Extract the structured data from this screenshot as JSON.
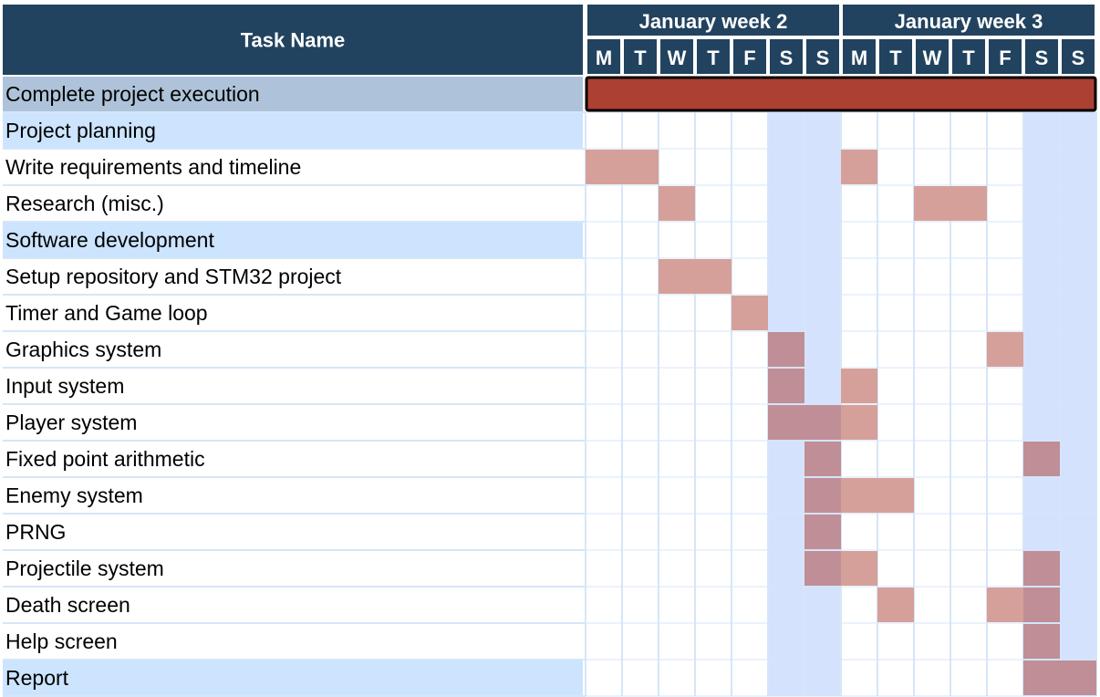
{
  "header": {
    "task_name_label": "Task Name",
    "weeks": [
      {
        "label": "January week 2",
        "days": [
          "M",
          "T",
          "W",
          "T",
          "F",
          "S",
          "S"
        ]
      },
      {
        "label": "January week 3",
        "days": [
          "M",
          "T",
          "W",
          "T",
          "F",
          "S",
          "S"
        ]
      }
    ]
  },
  "weekend_day_indices": [
    5,
    6,
    12,
    13
  ],
  "colors": {
    "header_bg": "#22435f",
    "summary_row": "#aec3d9",
    "group_row": "#cce4fd",
    "weekend_column": "#d5e2fe",
    "grid_line": "#d5e6f8",
    "summary_bar": "#ab4033",
    "task_block": "#d6a09a",
    "task_block_weekend": "#c08e97"
  },
  "chart_data": {
    "type": "gantt",
    "days": [
      "M",
      "T",
      "W",
      "T",
      "F",
      "S",
      "S",
      "M",
      "T",
      "W",
      "T",
      "F",
      "S",
      "S"
    ],
    "tasks": [
      {
        "name": "Complete project execution",
        "kind": "summary",
        "active_days": [
          0,
          1,
          2,
          3,
          4,
          5,
          6,
          7,
          8,
          9,
          10,
          11,
          12,
          13
        ]
      },
      {
        "name": "Project planning",
        "kind": "group",
        "active_days": []
      },
      {
        "name": "Write requirements and timeline",
        "kind": "task",
        "active_days": [
          0,
          1,
          7
        ]
      },
      {
        "name": "Research (misc.)",
        "kind": "task",
        "active_days": [
          2,
          9,
          10
        ]
      },
      {
        "name": "Software development",
        "kind": "group",
        "active_days": []
      },
      {
        "name": "Setup repository and STM32 project",
        "kind": "task",
        "active_days": [
          2,
          3
        ]
      },
      {
        "name": "Timer and Game loop",
        "kind": "task",
        "active_days": [
          4
        ]
      },
      {
        "name": "Graphics system",
        "kind": "task",
        "active_days": [
          5,
          11
        ]
      },
      {
        "name": "Input system",
        "kind": "task",
        "active_days": [
          5,
          7
        ]
      },
      {
        "name": "Player system",
        "kind": "task",
        "active_days": [
          5,
          6,
          7
        ]
      },
      {
        "name": "Fixed point arithmetic",
        "kind": "task",
        "active_days": [
          6,
          12
        ]
      },
      {
        "name": "Enemy system",
        "kind": "task",
        "active_days": [
          6,
          7,
          8
        ]
      },
      {
        "name": "PRNG",
        "kind": "task",
        "active_days": [
          6
        ]
      },
      {
        "name": "Projectile system",
        "kind": "task",
        "active_days": [
          6,
          7,
          12
        ]
      },
      {
        "name": "Death screen",
        "kind": "task",
        "active_days": [
          8,
          11,
          12
        ]
      },
      {
        "name": "Help screen",
        "kind": "task",
        "active_days": [
          12
        ]
      },
      {
        "name": "Report",
        "kind": "group",
        "active_days": [
          12,
          13
        ]
      }
    ]
  }
}
